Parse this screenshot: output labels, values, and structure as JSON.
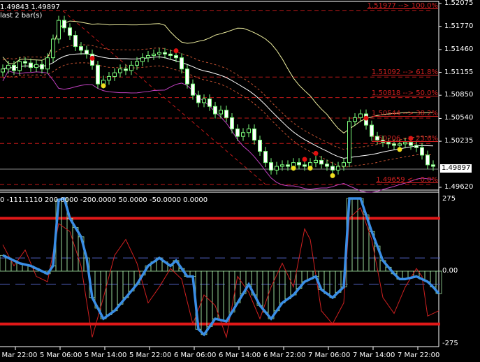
{
  "header": {
    "prices": "1.49843 1.49897",
    "note": "last 2 bar(s)",
    "leading_char": "'"
  },
  "price_axis": [
    "1.52075",
    "1.51770",
    "1.51460",
    "1.51155",
    "1.50850",
    "1.50540",
    "1.50235",
    "1.49620"
  ],
  "current_price": "1.49897",
  "fib_levels": [
    {
      "label": "1.51977 --> 100.0%",
      "price": 1.51977
    },
    {
      "label": "1.51092 --> 61.8%",
      "price": 1.51092
    },
    {
      "label": "1.50818 --> 50.0%",
      "price": 1.50818
    },
    {
      "label": "1.50544 --> 38.2%",
      "price": 1.50544
    },
    {
      "label": "1.50206 --> 23.6%",
      "price": 1.50206
    },
    {
      "label": "1.49659 <-- 0.0%",
      "price": 1.49659
    }
  ],
  "indicator": {
    "params": "0 -111.1110 200.0000 -200.0000 50.0000 -50.0000 0.0000",
    "axis": [
      "275",
      "0.00",
      "-275"
    ]
  },
  "time_axis": [
    "4 Mar 22:00",
    "5 Mar 06:00",
    "5 Mar 14:00",
    "5 Mar 22:00",
    "6 Mar 06:00",
    "6 Mar 14:00",
    "6 Mar 22:00",
    "7 Mar 06:00",
    "7 Mar 14:00",
    "7 Mar 22:00"
  ],
  "colors": {
    "bull": "#7cfc7c",
    "band_upper": "#f0f0a0",
    "band_mid": "#ffffff",
    "band_lower": "#c040c0",
    "envelope": "#c05030",
    "fib": "#c01818",
    "cci": "#3a8ee6",
    "osc": "#d02020",
    "hist": "#a0e0a0"
  },
  "chart_data": {
    "type": "line",
    "price_range": [
      1.4962,
      1.52075
    ],
    "closes": [
      1.512,
      1.5125,
      1.5118,
      1.513,
      1.5128,
      1.5122,
      1.5126,
      1.512,
      1.5135,
      1.516,
      1.5185,
      1.5175,
      1.5165,
      1.515,
      1.5145,
      1.514,
      1.5125,
      1.51,
      1.5105,
      1.511,
      1.5115,
      1.512,
      1.5118,
      1.5125,
      1.513,
      1.5135,
      1.5138,
      1.514,
      1.5142,
      1.514,
      1.5138,
      1.5135,
      1.512,
      1.51,
      1.5085,
      1.5075,
      1.508,
      1.507,
      1.506,
      1.5065,
      1.5055,
      1.504,
      1.503,
      1.5035,
      1.504,
      1.5025,
      1.501,
      1.4995,
      1.4985,
      1.499,
      1.4992,
      1.499,
      1.4995,
      1.4992,
      1.499,
      1.4995,
      1.4998,
      1.4993,
      1.499,
      1.4985,
      1.499,
      1.4995,
      1.505,
      1.5055,
      1.506,
      1.5045,
      1.503,
      1.5025,
      1.5022,
      1.502,
      1.5018,
      1.502,
      1.5022,
      1.5018,
      1.5015,
      1.5005,
      1.4992,
      1.499
    ],
    "red_dots": [
      16,
      31,
      54,
      56,
      65,
      73
    ],
    "yellow_dots": [
      18,
      52,
      55,
      59,
      71
    ],
    "osc_range": [
      -275,
      275
    ],
    "osc_levels": [
      200,
      -200,
      50,
      -50
    ],
    "cci": [
      [
        0,
        60
      ],
      [
        3,
        30
      ],
      [
        5,
        20
      ],
      [
        7,
        0
      ],
      [
        8,
        -10
      ],
      [
        9,
        20
      ],
      [
        10,
        270
      ],
      [
        11,
        275
      ],
      [
        12,
        200
      ],
      [
        14,
        130
      ],
      [
        15,
        50
      ],
      [
        16,
        -100
      ],
      [
        18,
        -180
      ],
      [
        20,
        -150
      ],
      [
        22,
        -100
      ],
      [
        24,
        -50
      ],
      [
        26,
        20
      ],
      [
        28,
        50
      ],
      [
        30,
        20
      ],
      [
        31,
        40
      ],
      [
        33,
        -20
      ],
      [
        34,
        -20
      ],
      [
        35,
        -220
      ],
      [
        36,
        -240
      ],
      [
        38,
        -180
      ],
      [
        40,
        -190
      ],
      [
        42,
        -120
      ],
      [
        44,
        -50
      ],
      [
        46,
        -130
      ],
      [
        48,
        -180
      ],
      [
        50,
        -120
      ],
      [
        52,
        -90
      ],
      [
        54,
        -40
      ],
      [
        56,
        -20
      ],
      [
        57,
        -70
      ],
      [
        59,
        -100
      ],
      [
        61,
        -60
      ],
      [
        62,
        275
      ],
      [
        64,
        275
      ],
      [
        66,
        150
      ],
      [
        68,
        40
      ],
      [
        70,
        -10
      ],
      [
        71,
        -30
      ],
      [
        72,
        -30
      ],
      [
        74,
        -20
      ],
      [
        76,
        -40
      ],
      [
        77,
        -60
      ],
      [
        78,
        -85
      ]
    ],
    "osc": [
      [
        0,
        100
      ],
      [
        2,
        20
      ],
      [
        4,
        80
      ],
      [
        6,
        -20
      ],
      [
        8,
        -40
      ],
      [
        10,
        180
      ],
      [
        12,
        150
      ],
      [
        14,
        20
      ],
      [
        16,
        -250
      ],
      [
        18,
        -100
      ],
      [
        20,
        60
      ],
      [
        22,
        120
      ],
      [
        24,
        30
      ],
      [
        26,
        -120
      ],
      [
        28,
        -60
      ],
      [
        30,
        10
      ],
      [
        32,
        -30
      ],
      [
        34,
        -200
      ],
      [
        36,
        -90
      ],
      [
        38,
        -130
      ],
      [
        40,
        -250
      ],
      [
        42,
        -20
      ],
      [
        44,
        -80
      ],
      [
        46,
        -180
      ],
      [
        48,
        -60
      ],
      [
        50,
        30
      ],
      [
        52,
        -60
      ],
      [
        54,
        160
      ],
      [
        55,
        120
      ],
      [
        57,
        -150
      ],
      [
        59,
        -200
      ],
      [
        61,
        -120
      ],
      [
        62,
        200
      ],
      [
        64,
        240
      ],
      [
        66,
        120
      ],
      [
        68,
        -100
      ],
      [
        70,
        -160
      ],
      [
        72,
        -60
      ],
      [
        74,
        10
      ],
      [
        75,
        -20
      ],
      [
        76,
        -170
      ],
      [
        78,
        -150
      ]
    ]
  }
}
